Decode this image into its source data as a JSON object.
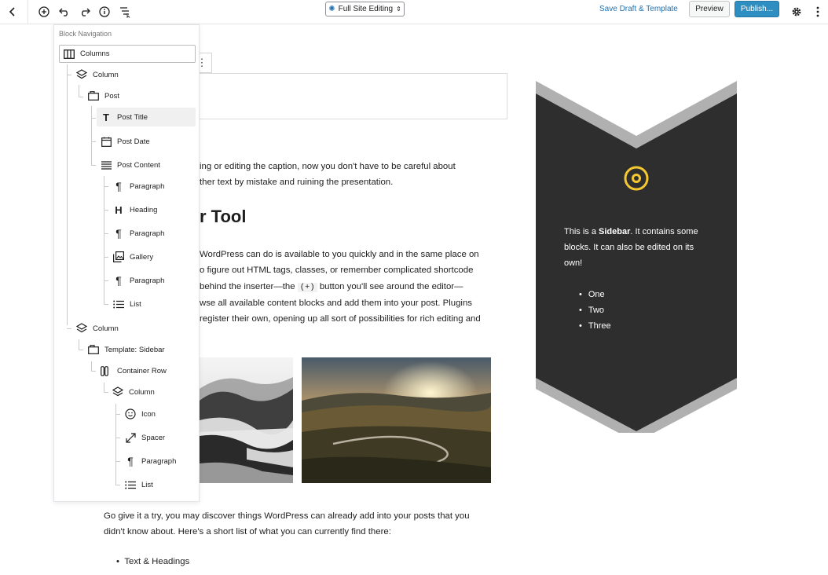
{
  "toolbar": {
    "site_editing_label": "Full Site Editing",
    "save_label": "Save Draft & Template",
    "preview_label": "Preview",
    "publish_label": "Publish..."
  },
  "block_navigation": {
    "title": "Block Navigation",
    "items": [
      {
        "label": "Columns",
        "icon": "columns-icon"
      },
      {
        "label": "Column",
        "icon": "column-icon"
      },
      {
        "label": "Post",
        "icon": "post-icon"
      },
      {
        "label": "Post Title",
        "icon": "title-icon"
      },
      {
        "label": "Post Date",
        "icon": "calendar-icon"
      },
      {
        "label": "Post Content",
        "icon": "content-icon"
      },
      {
        "label": "Paragraph",
        "icon": "paragraph-icon"
      },
      {
        "label": "Heading",
        "icon": "heading-icon"
      },
      {
        "label": "Paragraph",
        "icon": "paragraph-icon"
      },
      {
        "label": "Gallery",
        "icon": "gallery-icon"
      },
      {
        "label": "Paragraph",
        "icon": "paragraph-icon"
      },
      {
        "label": "List",
        "icon": "list-icon"
      },
      {
        "label": "Column",
        "icon": "column-icon"
      },
      {
        "label": "Template: Sidebar",
        "icon": "template-icon"
      },
      {
        "label": "Container Row",
        "icon": "container-row-icon"
      },
      {
        "label": "Column",
        "icon": "column-icon"
      },
      {
        "label": "Icon",
        "icon": "smiley-icon"
      },
      {
        "label": "Spacer",
        "icon": "spacer-icon"
      },
      {
        "label": "Paragraph",
        "icon": "paragraph-icon"
      },
      {
        "label": "List",
        "icon": "list-icon"
      }
    ]
  },
  "content": {
    "para1_line1": "ing or editing the caption, now you don't have to be careful about",
    "para1_line2": "ther text by mistake and ruining the presentation.",
    "heading": "r Tool",
    "para2_line1": "WordPress can do is available to you quickly and in the same place on",
    "para2_line2": "o figure out HTML tags, classes, or remember complicated shortcode",
    "para2_line3_pre": "behind the inserter—the ",
    "para2_line3_code": "(+)",
    "para2_line3_post": " button you'll see around the editor—",
    "para2_line4": "wse all available content blocks and add them into your post. Plugins",
    "para2_line5": "register their own, opening up all sort of possibilities for rich editing and",
    "para3_line1": "Go give it a try, you may discover things WordPress can already add into your posts that you",
    "para3_line2": "didn't know about. Here's a short list of what you can currently find there:",
    "bullet1": "Text & Headings"
  },
  "sidebar": {
    "text_pre": "This is a ",
    "text_bold": "Sidebar",
    "text_post": ". It contains some blocks. It can also be edited on its own!",
    "list": [
      "One",
      "Two",
      "Three"
    ],
    "accent_color": "#f5c832",
    "bg_color": "#2e2e2e"
  }
}
